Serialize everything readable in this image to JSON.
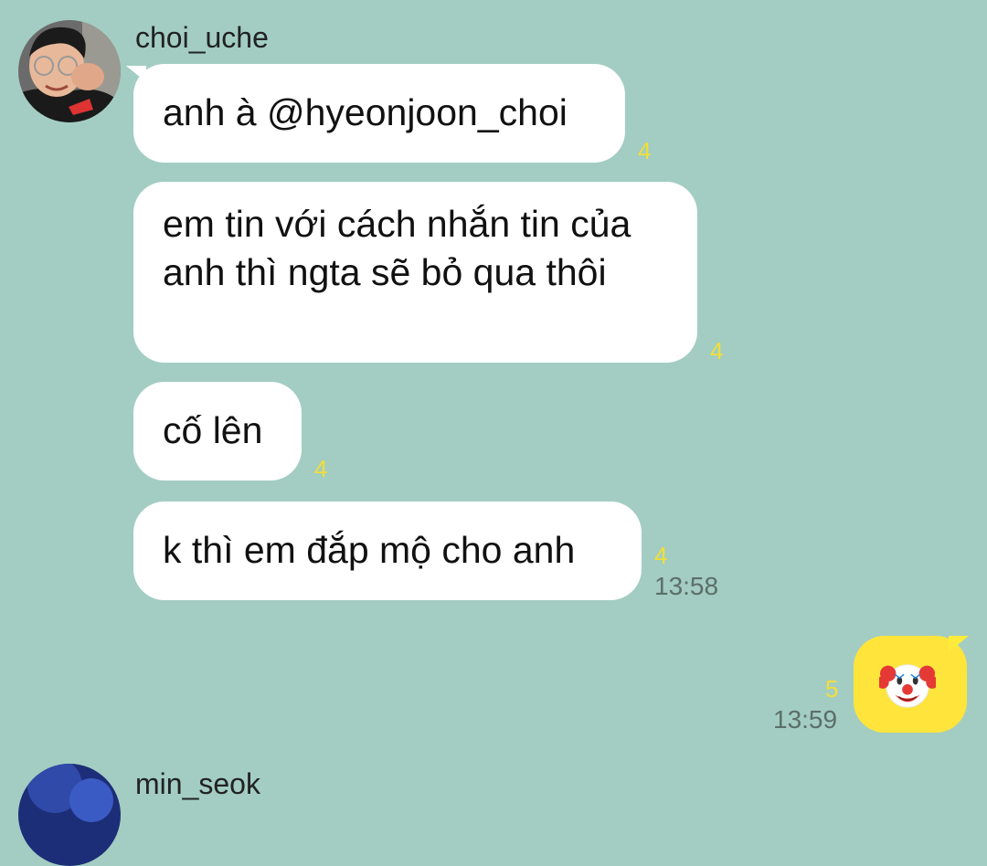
{
  "messages_incoming": {
    "sender": "choi_uche",
    "items": [
      {
        "text": "anh à @hyeonjoon_choi",
        "unread": "4"
      },
      {
        "text": "em tin với cách nhắn tin của anh thì ngta sẽ bỏ qua thôi",
        "unread": "4"
      },
      {
        "text": "cố lên",
        "unread": "4"
      },
      {
        "text": "k thì em đắp mộ cho anh",
        "unread": "4",
        "time": "13:58"
      }
    ]
  },
  "message_outgoing": {
    "content_icon": "clown-face-emoji",
    "unread": "5",
    "time": "13:59"
  },
  "next_sender": {
    "name": "min_seok"
  },
  "colors": {
    "background": "#a3cdc2",
    "incoming_bubble": "#ffffff",
    "outgoing_bubble": "#ffe53b",
    "unread_count": "#f2de39",
    "timestamp": "#5c6e68"
  }
}
